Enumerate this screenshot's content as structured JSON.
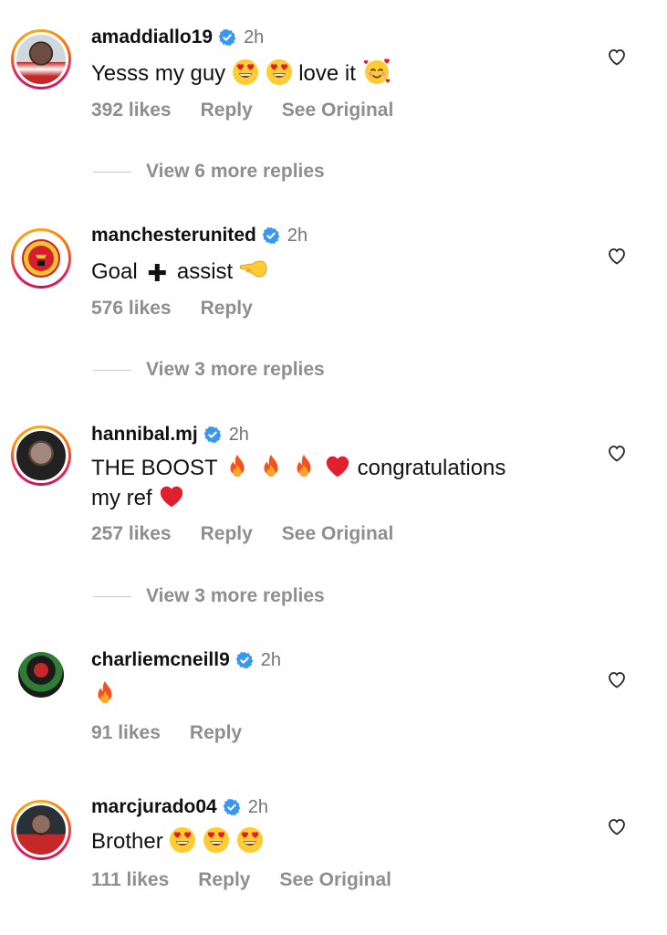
{
  "comments": [
    {
      "username": "amaddiallo19",
      "time": "2h",
      "text_parts": [
        "Yesss my guy",
        "love it"
      ],
      "likes": "392 likes",
      "reply": "Reply",
      "see_original": "See Original",
      "view_replies": "View 6 more replies"
    },
    {
      "username": "manchesterunited",
      "time": "2h",
      "text_parts": [
        "Goal",
        "assist"
      ],
      "likes": "576 likes",
      "reply": "Reply",
      "view_replies": "View 3 more replies"
    },
    {
      "username": "hannibal.mj",
      "time": "2h",
      "text_parts": [
        "THE BOOST",
        "congratulations",
        "my ref"
      ],
      "likes": "257 likes",
      "reply": "Reply",
      "see_original": "See Original",
      "view_replies": "View 3 more replies"
    },
    {
      "username": "charliemcneill9",
      "time": "2h",
      "likes": "91 likes",
      "reply": "Reply"
    },
    {
      "username": "marcjurado04",
      "time": "2h",
      "text_parts": [
        "Brother"
      ],
      "likes": "111 likes",
      "reply": "Reply",
      "see_original": "See Original"
    }
  ],
  "colors": {
    "verified": "#3897f0",
    "meta": "#8e8e8e",
    "time": "#737373"
  }
}
